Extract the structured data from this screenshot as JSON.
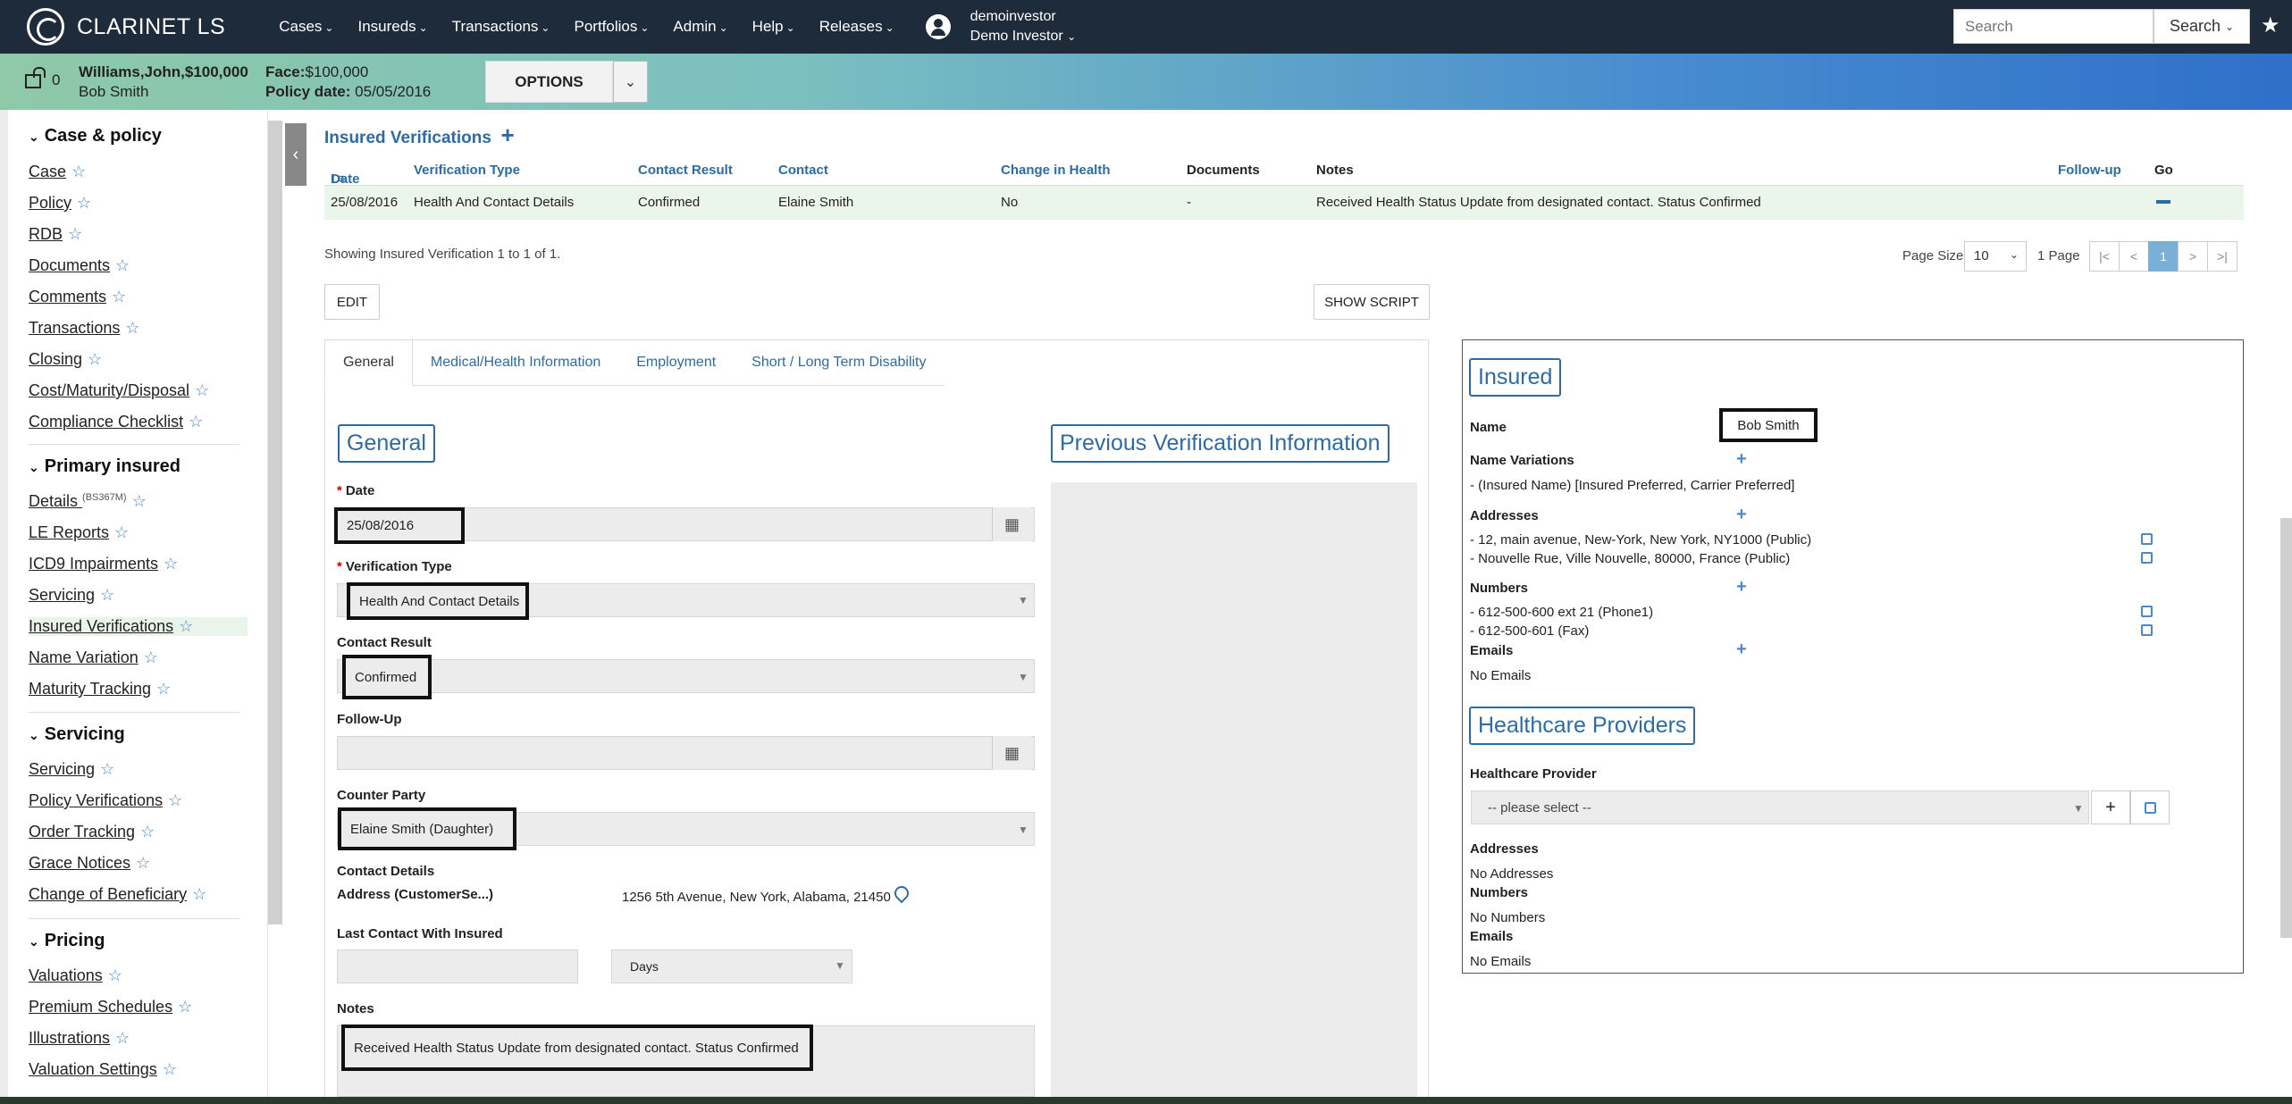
{
  "app": {
    "title": "CLARINET LS"
  },
  "nav": {
    "items": [
      "Cases",
      "Insureds",
      "Transactions",
      "Portfolios",
      "Admin",
      "Help",
      "Releases"
    ],
    "user_login": "demoinvestor",
    "user_name": "Demo Investor",
    "search_placeholder": "Search",
    "search_button": "Search"
  },
  "policy_bar": {
    "lock_count": "0",
    "case_title": "Williams,John,$100,000",
    "insured_name": "Bob Smith",
    "face_label": "Face:",
    "face_value": "$100,000",
    "policy_date_label": "Policy date:",
    "policy_date_value": "05/05/2016",
    "options_label": "OPTIONS"
  },
  "sidebar": {
    "sections": [
      {
        "title": "Case & policy",
        "items": [
          "Case",
          "Policy",
          "RDB",
          "Documents",
          "Comments",
          "Transactions",
          "Closing",
          "Cost/Maturity/Disposal",
          "Compliance Checklist"
        ]
      },
      {
        "title": "Primary insured",
        "items": [
          "Details",
          "LE Reports",
          "ICD9 Impairments",
          "Servicing",
          "Insured Verifications",
          "Name Variation",
          "Maturity Tracking"
        ]
      },
      {
        "title": "Servicing",
        "items": [
          "Servicing",
          "Policy Verifications",
          "Order Tracking",
          "Grace Notices",
          "Change of Beneficiary"
        ]
      },
      {
        "title": "Pricing",
        "items": [
          "Valuations",
          "Premium Schedules",
          "Illustrations",
          "Valuation Settings"
        ]
      }
    ],
    "details_tag": "(BS367M)",
    "active_item": "Insured Verifications"
  },
  "verifications": {
    "title": "Insured Verifications",
    "columns": [
      "Date",
      "Verification Type",
      "Contact Result",
      "Contact",
      "Change in Health",
      "Documents",
      "Notes",
      "Follow-up",
      "Go"
    ],
    "rows": [
      {
        "date": "25/08/2016",
        "type": "Health And Contact Details",
        "result": "Confirmed",
        "contact": "Elaine Smith",
        "change": "No",
        "documents": "-",
        "notes": "Received Health Status Update from designated contact. Status Confirmed",
        "followup": ""
      }
    ],
    "showing": "Showing Insured Verification 1 to 1 of 1.",
    "page_size_label": "Page Size",
    "page_size_value": "10",
    "page_count": "1 Page",
    "pager": [
      "|<",
      "<",
      "1",
      ">",
      ">|"
    ],
    "current_page": "1"
  },
  "buttons": {
    "edit": "EDIT",
    "show_script": "SHOW SCRIPT"
  },
  "tabs": [
    "General",
    "Medical/Health Information",
    "Employment",
    "Short / Long Term Disability"
  ],
  "general": {
    "heading": "General",
    "date_label": "Date",
    "date_value": "25/08/2016",
    "verification_type_label": "Verification Type",
    "verification_type_value": "Health And Contact Details",
    "contact_result_label": "Contact Result",
    "contact_result_value": "Confirmed",
    "follow_up_label": "Follow-Up",
    "counter_party_label": "Counter Party",
    "counter_party_value": "Elaine Smith (Daughter)",
    "contact_details_label": "Contact Details",
    "address_label": "Address (CustomerSe...)",
    "address_value": "1256 5th Avenue, New York, Alabama, 21450",
    "last_contact_label": "Last Contact With Insured",
    "days_value": "Days",
    "notes_label": "Notes",
    "notes_value": "Received Health Status Update from designated contact. Status Confirmed"
  },
  "previous": {
    "heading": "Previous Verification Information"
  },
  "insured": {
    "heading": "Insured",
    "name_label": "Name",
    "name_value": "Bob Smith",
    "name_variations_label": "Name Variations",
    "name_variation_value": "- (Insured Name) [Insured Preferred, Carrier Preferred]",
    "addresses_label": "Addresses",
    "addresses": [
      "- 12, main avenue, New-York, New York, NY1000 (Public)",
      "- Nouvelle Rue, Ville Nouvelle, 80000, France (Public)"
    ],
    "numbers_label": "Numbers",
    "numbers": [
      "- 612-500-600 ext 21 (Phone1)",
      "- 612-500-601 (Fax)"
    ],
    "emails_label": "Emails",
    "emails_value": "No Emails"
  },
  "healthcare": {
    "heading": "Healthcare Providers",
    "provider_label": "Healthcare Provider",
    "provider_placeholder": "-- please select --",
    "addresses_label": "Addresses",
    "addresses_value": "No Addresses",
    "numbers_label": "Numbers",
    "numbers_value": "No Numbers",
    "emails_label": "Emails",
    "emails_value": "No Emails"
  }
}
